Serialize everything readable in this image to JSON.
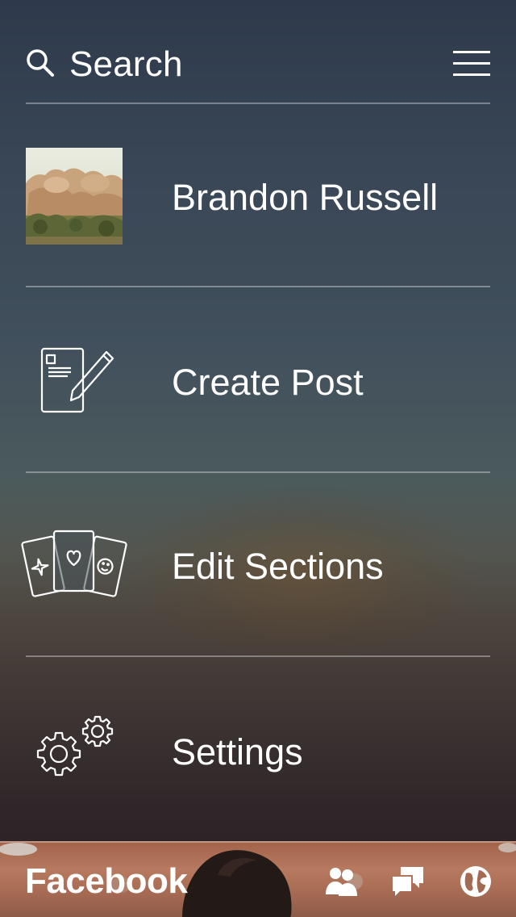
{
  "search": {
    "label": "Search",
    "icon": "search-icon"
  },
  "header": {
    "menu_icon": "hamburger-menu-icon"
  },
  "menu": {
    "items": [
      {
        "label": "Brandon Russell",
        "icon": "profile-photo"
      },
      {
        "label": "Create Post",
        "icon": "compose-post-icon"
      },
      {
        "label": "Edit Sections",
        "icon": "sections-cards-icon"
      },
      {
        "label": "Settings",
        "icon": "gears-icon"
      }
    ]
  },
  "bottom_bar": {
    "brand": "Facebook",
    "icons": [
      "friend-requests-icon",
      "messages-icon",
      "notifications-globe-icon"
    ]
  },
  "colors": {
    "text": "#ffffff",
    "divider": "rgba(255,255,255,0.35)",
    "background_top": "#2e3a4b",
    "background_bottom": "#272025",
    "bottom_bar": "#a2634a"
  }
}
